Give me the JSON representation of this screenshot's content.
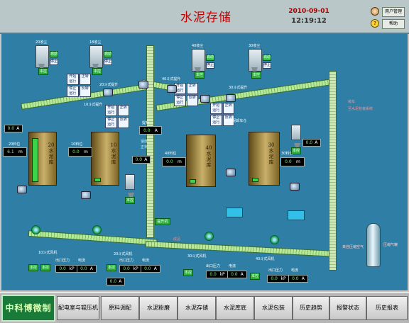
{
  "header": {
    "title": "水泥存储",
    "date": "2010-09-01",
    "time": "12:19:12",
    "user_btn": "用户管理",
    "help_btn": "帮助"
  },
  "dust": [
    {
      "label": "20收尘"
    },
    {
      "label": "18收尘"
    },
    {
      "label": "40收尘"
    },
    {
      "label": "30收尘"
    }
  ],
  "ctrl": {
    "start": "启动",
    "stop": "停止",
    "local": "本地",
    "remote": "远程",
    "start_run": "开始运行",
    "stop_run": "停止运行",
    "forward": "正转",
    "reverse": "反转",
    "speed": "中速",
    "plant": "本控"
  },
  "silos": [
    {
      "name": "20水泥库",
      "level_label": "20料位",
      "level": "6.1",
      "unit": "m"
    },
    {
      "name": "10水泥库",
      "level_label": "10料位",
      "level": "0.0",
      "unit": "m"
    },
    {
      "name": "40水泥库",
      "level_label": "40料位",
      "level": "0.0",
      "unit": "m"
    },
    {
      "name": "30水泥库",
      "level_label": "30料位",
      "level": "0.0",
      "unit": "m"
    }
  ],
  "labels": {
    "conv20": "20斗式提升",
    "conv10": "10斗式提升",
    "conv40": "40斗式提升",
    "conv30": "30斗式提升",
    "elev": "提升",
    "elev_speed": "速度",
    "elev_ok": "正常",
    "hoist": "提升机",
    "product": "成品",
    "bin_fill": "装车",
    "to_pack": "至水泥包装系统",
    "air": "来自压缩空气",
    "to_next": "压缩气罐",
    "fan_a": "10斗式风机",
    "fan_b": "20斗式风机",
    "fan_c": "30斗式风机",
    "fan_d": "40斗式风机",
    "outlet": "出口压力",
    "current": "电流",
    "pump40": "40水泥卸车仓"
  },
  "readouts": [
    {
      "v": "0.0",
      "u": "A"
    },
    {
      "v": "0.0",
      "u": "A"
    },
    {
      "v": "0.0",
      "u": "A"
    },
    {
      "v": "0.0",
      "u": "kP"
    },
    {
      "v": "0.0",
      "u": "A"
    },
    {
      "v": "0.0",
      "u": "kP"
    },
    {
      "v": "0.0",
      "u": "A"
    },
    {
      "v": "0.0",
      "u": "kP"
    },
    {
      "v": "0.0",
      "u": "A"
    },
    {
      "v": "0.0",
      "u": "kP"
    },
    {
      "v": "0.0",
      "u": "A"
    },
    {
      "v": "0.0",
      "u": "A"
    },
    {
      "v": "0.0",
      "u": "A"
    }
  ],
  "nav": {
    "logo": "中科博微制",
    "items": [
      "配电室与辊压机",
      "原料调配",
      "水泥粉磨",
      "水泥存储",
      "水泥库底",
      "水泥包装",
      "历史趋势",
      "报警状态",
      "历史报表"
    ]
  },
  "colors": {
    "canvas": "#2e7ea5",
    "accent": "#c00000",
    "status_green": "#28b03a"
  }
}
